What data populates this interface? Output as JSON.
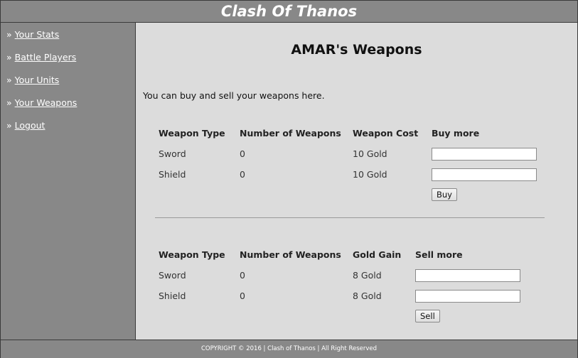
{
  "header": {
    "title": "Clash Of Thanos"
  },
  "sidebar": {
    "prefix": "»",
    "items": [
      {
        "label": "Your Stats"
      },
      {
        "label": "Battle Players"
      },
      {
        "label": "Your Units"
      },
      {
        "label": "Your Weapons"
      },
      {
        "label": "Logout"
      }
    ]
  },
  "main": {
    "title": "AMAR's Weapons",
    "intro": "You can buy and sell your weapons here.",
    "buy_table": {
      "headers": [
        "Weapon Type",
        "Number of Weapons",
        "Weapon Cost",
        "Buy more"
      ],
      "rows": [
        {
          "type": "Sword",
          "count": "0",
          "price": "10 Gold",
          "input": ""
        },
        {
          "type": "Shield",
          "count": "0",
          "price": "10 Gold",
          "input": ""
        }
      ],
      "button": "Buy"
    },
    "sell_table": {
      "headers": [
        "Weapon Type",
        "Number of Weapons",
        "Gold Gain",
        "Sell more"
      ],
      "rows": [
        {
          "type": "Sword",
          "count": "0",
          "price": "8 Gold",
          "input": ""
        },
        {
          "type": "Shield",
          "count": "0",
          "price": "8 Gold",
          "input": ""
        }
      ],
      "button": "Sell"
    }
  },
  "footer": {
    "text": "COPYRIGHT © 2016 | Clash of Thanos | All Right Reserved"
  }
}
